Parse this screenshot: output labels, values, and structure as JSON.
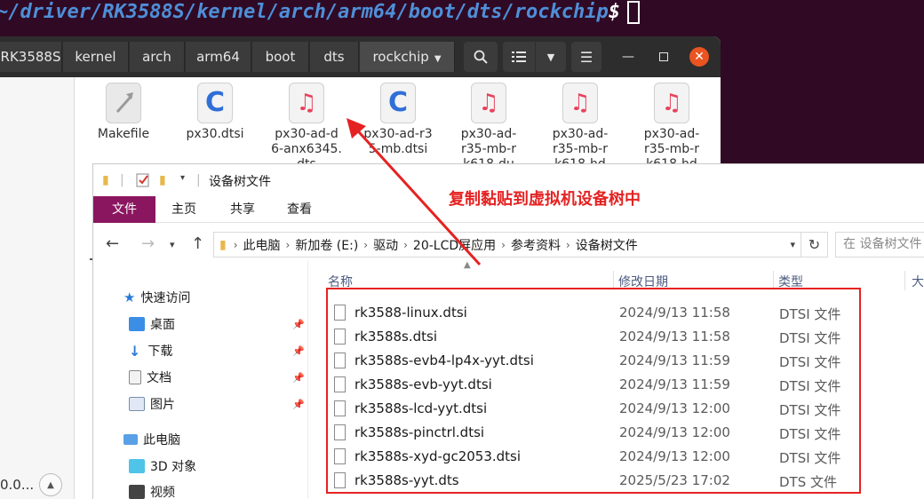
{
  "terminal": {
    "path": "~/driver/RK3588S/kernel/arch/arm64/boot/dts/rockchip",
    "prompt": "$"
  },
  "nautilus": {
    "breadcrumbs": [
      "RK3588S",
      "kernel",
      "arch",
      "arm64",
      "boot",
      "dts",
      "rockchip"
    ],
    "header_icons": [
      "search-icon",
      "list-view-icon",
      "chevron-down-icon",
      "menu-icon",
      "minimize-icon",
      "maximize-icon",
      "close-icon"
    ],
    "files": [
      {
        "name": "Makefile",
        "icon": "executable-icon"
      },
      {
        "name": "px30.dtsi",
        "icon": "c-source-icon"
      },
      {
        "name": "px30-ad-d6-anx6345.dts",
        "icon": "music-icon"
      },
      {
        "name": "px30-ad-r35-mb.dtsi",
        "icon": "c-source-icon"
      },
      {
        "name": "px30-ad-r35-mb-rk618-du",
        "icon": "music-icon"
      },
      {
        "name": "px30-ad-r35-mb-rk618-hd",
        "icon": "music-icon"
      },
      {
        "name": "px30-ad-r35-mb-rk618-hd",
        "icon": "music-icon"
      }
    ],
    "sidebar_truncated_text": "0.0..."
  },
  "annotation": {
    "text": "复制黏贴到虚拟机设备树中",
    "color": "#e52222"
  },
  "explorer": {
    "title": "设备树文件",
    "ribbon_tabs": [
      "文件",
      "主页",
      "共享",
      "查看"
    ],
    "address": [
      "此电脑",
      "新加卷 (E:)",
      "驱动",
      "20-LCD屏应用",
      "参考资料",
      "设备树文件"
    ],
    "search_placeholder": "在 设备树文件",
    "sidebar": {
      "quick_access": "快速访问",
      "items": [
        "桌面",
        "下载",
        "文档",
        "图片"
      ],
      "this_pc": "此电脑",
      "pc_items": [
        "3D 对象",
        "视频"
      ]
    },
    "columns": [
      "名称",
      "修改日期",
      "类型",
      "大"
    ],
    "files": [
      {
        "name": "rk3588-linux.dtsi",
        "date": "2024/9/13 11:58",
        "type": "DTSI 文件"
      },
      {
        "name": "rk3588s.dtsi",
        "date": "2024/9/13 11:58",
        "type": "DTSI 文件"
      },
      {
        "name": "rk3588s-evb4-lp4x-yyt.dtsi",
        "date": "2024/9/13 11:59",
        "type": "DTSI 文件"
      },
      {
        "name": "rk3588s-evb-yyt.dtsi",
        "date": "2024/9/13 11:59",
        "type": "DTSI 文件"
      },
      {
        "name": "rk3588s-lcd-yyt.dtsi",
        "date": "2024/9/13 12:00",
        "type": "DTSI 文件"
      },
      {
        "name": "rk3588s-pinctrl.dtsi",
        "date": "2024/9/13 12:00",
        "type": "DTSI 文件"
      },
      {
        "name": "rk3588s-xyd-gc2053.dtsi",
        "date": "2024/9/13 12:00",
        "type": "DTSI 文件"
      },
      {
        "name": "rk3588s-yyt.dts",
        "date": "2025/5/23 17:02",
        "type": "DTS 文件"
      }
    ]
  }
}
